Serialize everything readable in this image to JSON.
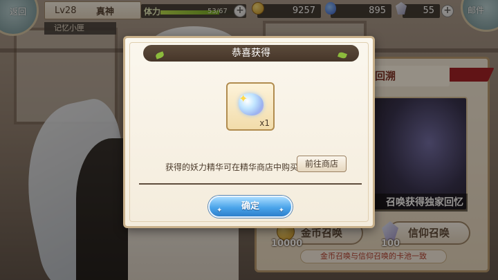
{
  "hud": {
    "back_label": "返回",
    "level": "Lv28",
    "player_name": "真神",
    "memory_box": "记忆小匣",
    "stamina_label": "体力",
    "stamina_value": "53/67",
    "stamina_fraction": 0.79,
    "gold": "9257",
    "faith": "895",
    "gems": "55",
    "mail_label": "邮件"
  },
  "event": {
    "banner_title": "回溯",
    "caption": "召唤获得独家回忆",
    "gold_summon_label": "金币召唤",
    "faith_summon_label": "信仰召唤",
    "gold_summon_cost": "10000",
    "faith_summon_cost": "100",
    "note": "金币召唤与信仰召唤的卡池一致"
  },
  "dialog": {
    "title": "恭喜获得",
    "item_icon": "yaoli-essence-crystal-icon",
    "item_quantity": "x1",
    "info_text": "获得的妖力精华可在精华商店中购买",
    "shop_button": "前往商店",
    "confirm_button": "确定"
  },
  "colors": {
    "dialog_bg": "#fbf7ee",
    "header_bg": "#5c4a3b",
    "confirm_blue": "#4aa4ea",
    "stamina_green": "#8cc63f"
  }
}
